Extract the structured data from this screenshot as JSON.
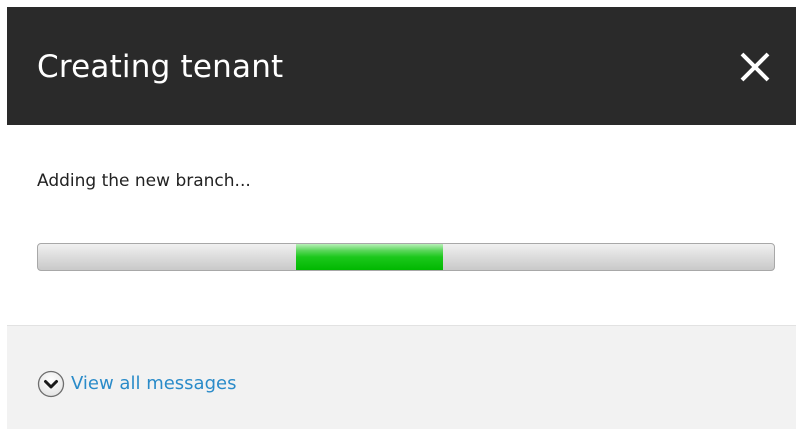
{
  "dialog": {
    "title": "Creating tenant",
    "close_icon": "close-icon"
  },
  "content": {
    "status_text": "Adding the new branch...",
    "progress": {
      "mode": "indeterminate",
      "segment_start_fraction": 0.35,
      "segment_end_fraction": 0.55
    }
  },
  "footer": {
    "view_all_label": "View all messages",
    "toggle_icon": "chevron-down-circle-icon"
  },
  "colors": {
    "title_bar": "#2a2a2a",
    "progress_fill": "#00c000",
    "link": "#2a8bc9",
    "footer_bg": "#f2f2f2"
  }
}
